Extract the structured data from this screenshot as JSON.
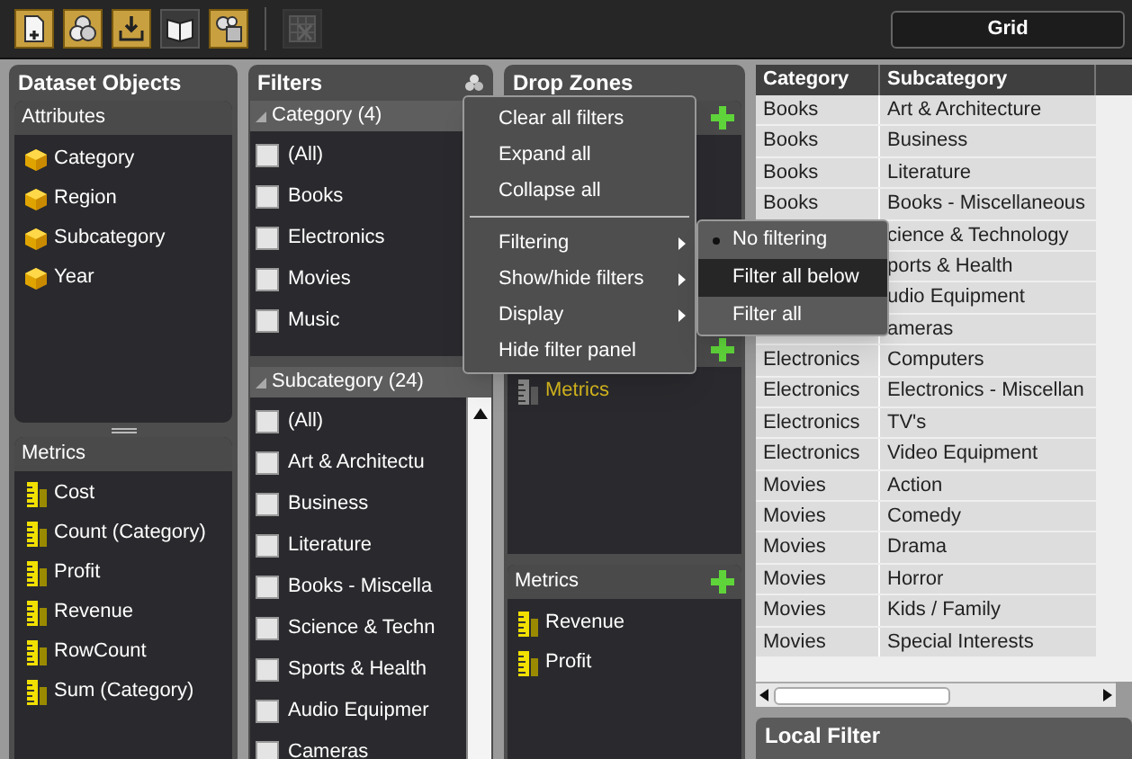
{
  "toolbar": {
    "buttons": [
      {
        "kind": "new-document",
        "disabled": false
      },
      {
        "kind": "circles",
        "disabled": false
      },
      {
        "kind": "download",
        "disabled": false
      },
      {
        "kind": "book",
        "disabled": false
      },
      {
        "kind": "shapes",
        "disabled": false
      },
      {
        "kind": "grid-delete",
        "disabled": true
      }
    ],
    "view_button": "Grid"
  },
  "dataset_objects": {
    "title": "Dataset Objects",
    "attributes": {
      "title": "Attributes",
      "items": [
        "Category",
        "Region",
        "Subcategory",
        "Year"
      ]
    },
    "metrics": {
      "title": "Metrics",
      "items": [
        "Cost",
        "Count (Category)",
        "Profit",
        "Revenue",
        "RowCount",
        "Sum (Category)"
      ]
    }
  },
  "filters": {
    "title": "Filters",
    "groups": [
      {
        "title": "Category (4)",
        "expanded": true,
        "scrollbar": false,
        "items": [
          {
            "label": "(All)",
            "checked": false
          },
          {
            "label": "Books",
            "checked": false
          },
          {
            "label": "Electronics",
            "checked": false
          },
          {
            "label": "Movies",
            "checked": false
          },
          {
            "label": "Music",
            "checked": false
          }
        ]
      },
      {
        "title": "Subcategory (24)",
        "expanded": true,
        "scrollbar": true,
        "items": [
          {
            "label": "(All)",
            "checked": false
          },
          {
            "label": "Art & Architectu",
            "checked": false
          },
          {
            "label": "Business",
            "checked": false
          },
          {
            "label": "Literature",
            "checked": false
          },
          {
            "label": "Books - Miscella",
            "checked": false
          },
          {
            "label": "Science & Techn",
            "checked": false
          },
          {
            "label": "Sports & Health",
            "checked": false
          },
          {
            "label": "Audio Equipmer",
            "checked": false
          },
          {
            "label": "Cameras",
            "checked": false
          }
        ]
      }
    ]
  },
  "drop_zones": {
    "title": "Drop Zones",
    "sections": [
      {
        "add_button": true
      },
      {
        "add_button": true,
        "items": [
          {
            "label": "Metrics",
            "kind": "placeholder"
          }
        ]
      },
      {
        "title": "Metrics",
        "add_button": true,
        "items": [
          {
            "label": "Revenue",
            "kind": "metric"
          },
          {
            "label": "Profit",
            "kind": "metric"
          }
        ]
      }
    ]
  },
  "context_menu": {
    "items": [
      {
        "kind": "item",
        "label": "Clear all filters"
      },
      {
        "kind": "item",
        "label": "Expand all"
      },
      {
        "kind": "item",
        "label": "Collapse all"
      },
      {
        "kind": "separator"
      },
      {
        "kind": "submenu",
        "label": "Filtering"
      },
      {
        "kind": "submenu",
        "label": "Show/hide filters"
      },
      {
        "kind": "submenu",
        "label": "Display"
      },
      {
        "kind": "item",
        "label": "Hide filter panel"
      }
    ],
    "submenu": [
      {
        "label": "No filtering",
        "selected": true,
        "highlighted": false
      },
      {
        "label": "Filter all below",
        "selected": false,
        "highlighted": true
      },
      {
        "label": "Filter all",
        "selected": false,
        "highlighted": false
      }
    ]
  },
  "grid": {
    "columns": [
      "Category",
      "Subcategory"
    ],
    "rows": [
      {
        "category": "Books",
        "subcategory": "Art & Architecture"
      },
      {
        "category": "Books",
        "subcategory": "Business"
      },
      {
        "category": "Books",
        "subcategory": "Literature"
      },
      {
        "category": "Books",
        "subcategory": "Books - Miscellaneous"
      },
      {
        "subcategory": "cience & Technology"
      },
      {
        "subcategory": "ports & Health"
      },
      {
        "subcategory": "udio Equipment"
      },
      {
        "subcategory": "ameras"
      },
      {
        "category": "Electronics",
        "subcategory": "Computers"
      },
      {
        "category": "Electronics",
        "subcategory": "Electronics - Miscellan"
      },
      {
        "category": "Electronics",
        "subcategory": "TV's"
      },
      {
        "category": "Electronics",
        "subcategory": "Video Equipment"
      },
      {
        "category": "Movies",
        "subcategory": "Action"
      },
      {
        "category": "Movies",
        "subcategory": "Comedy"
      },
      {
        "category": "Movies",
        "subcategory": "Drama"
      },
      {
        "category": "Movies",
        "subcategory": "Horror"
      },
      {
        "category": "Movies",
        "subcategory": "Kids / Family"
      },
      {
        "category": "Movies",
        "subcategory": "Special Interests"
      }
    ]
  },
  "local_filter": {
    "title": "Local Filter"
  }
}
